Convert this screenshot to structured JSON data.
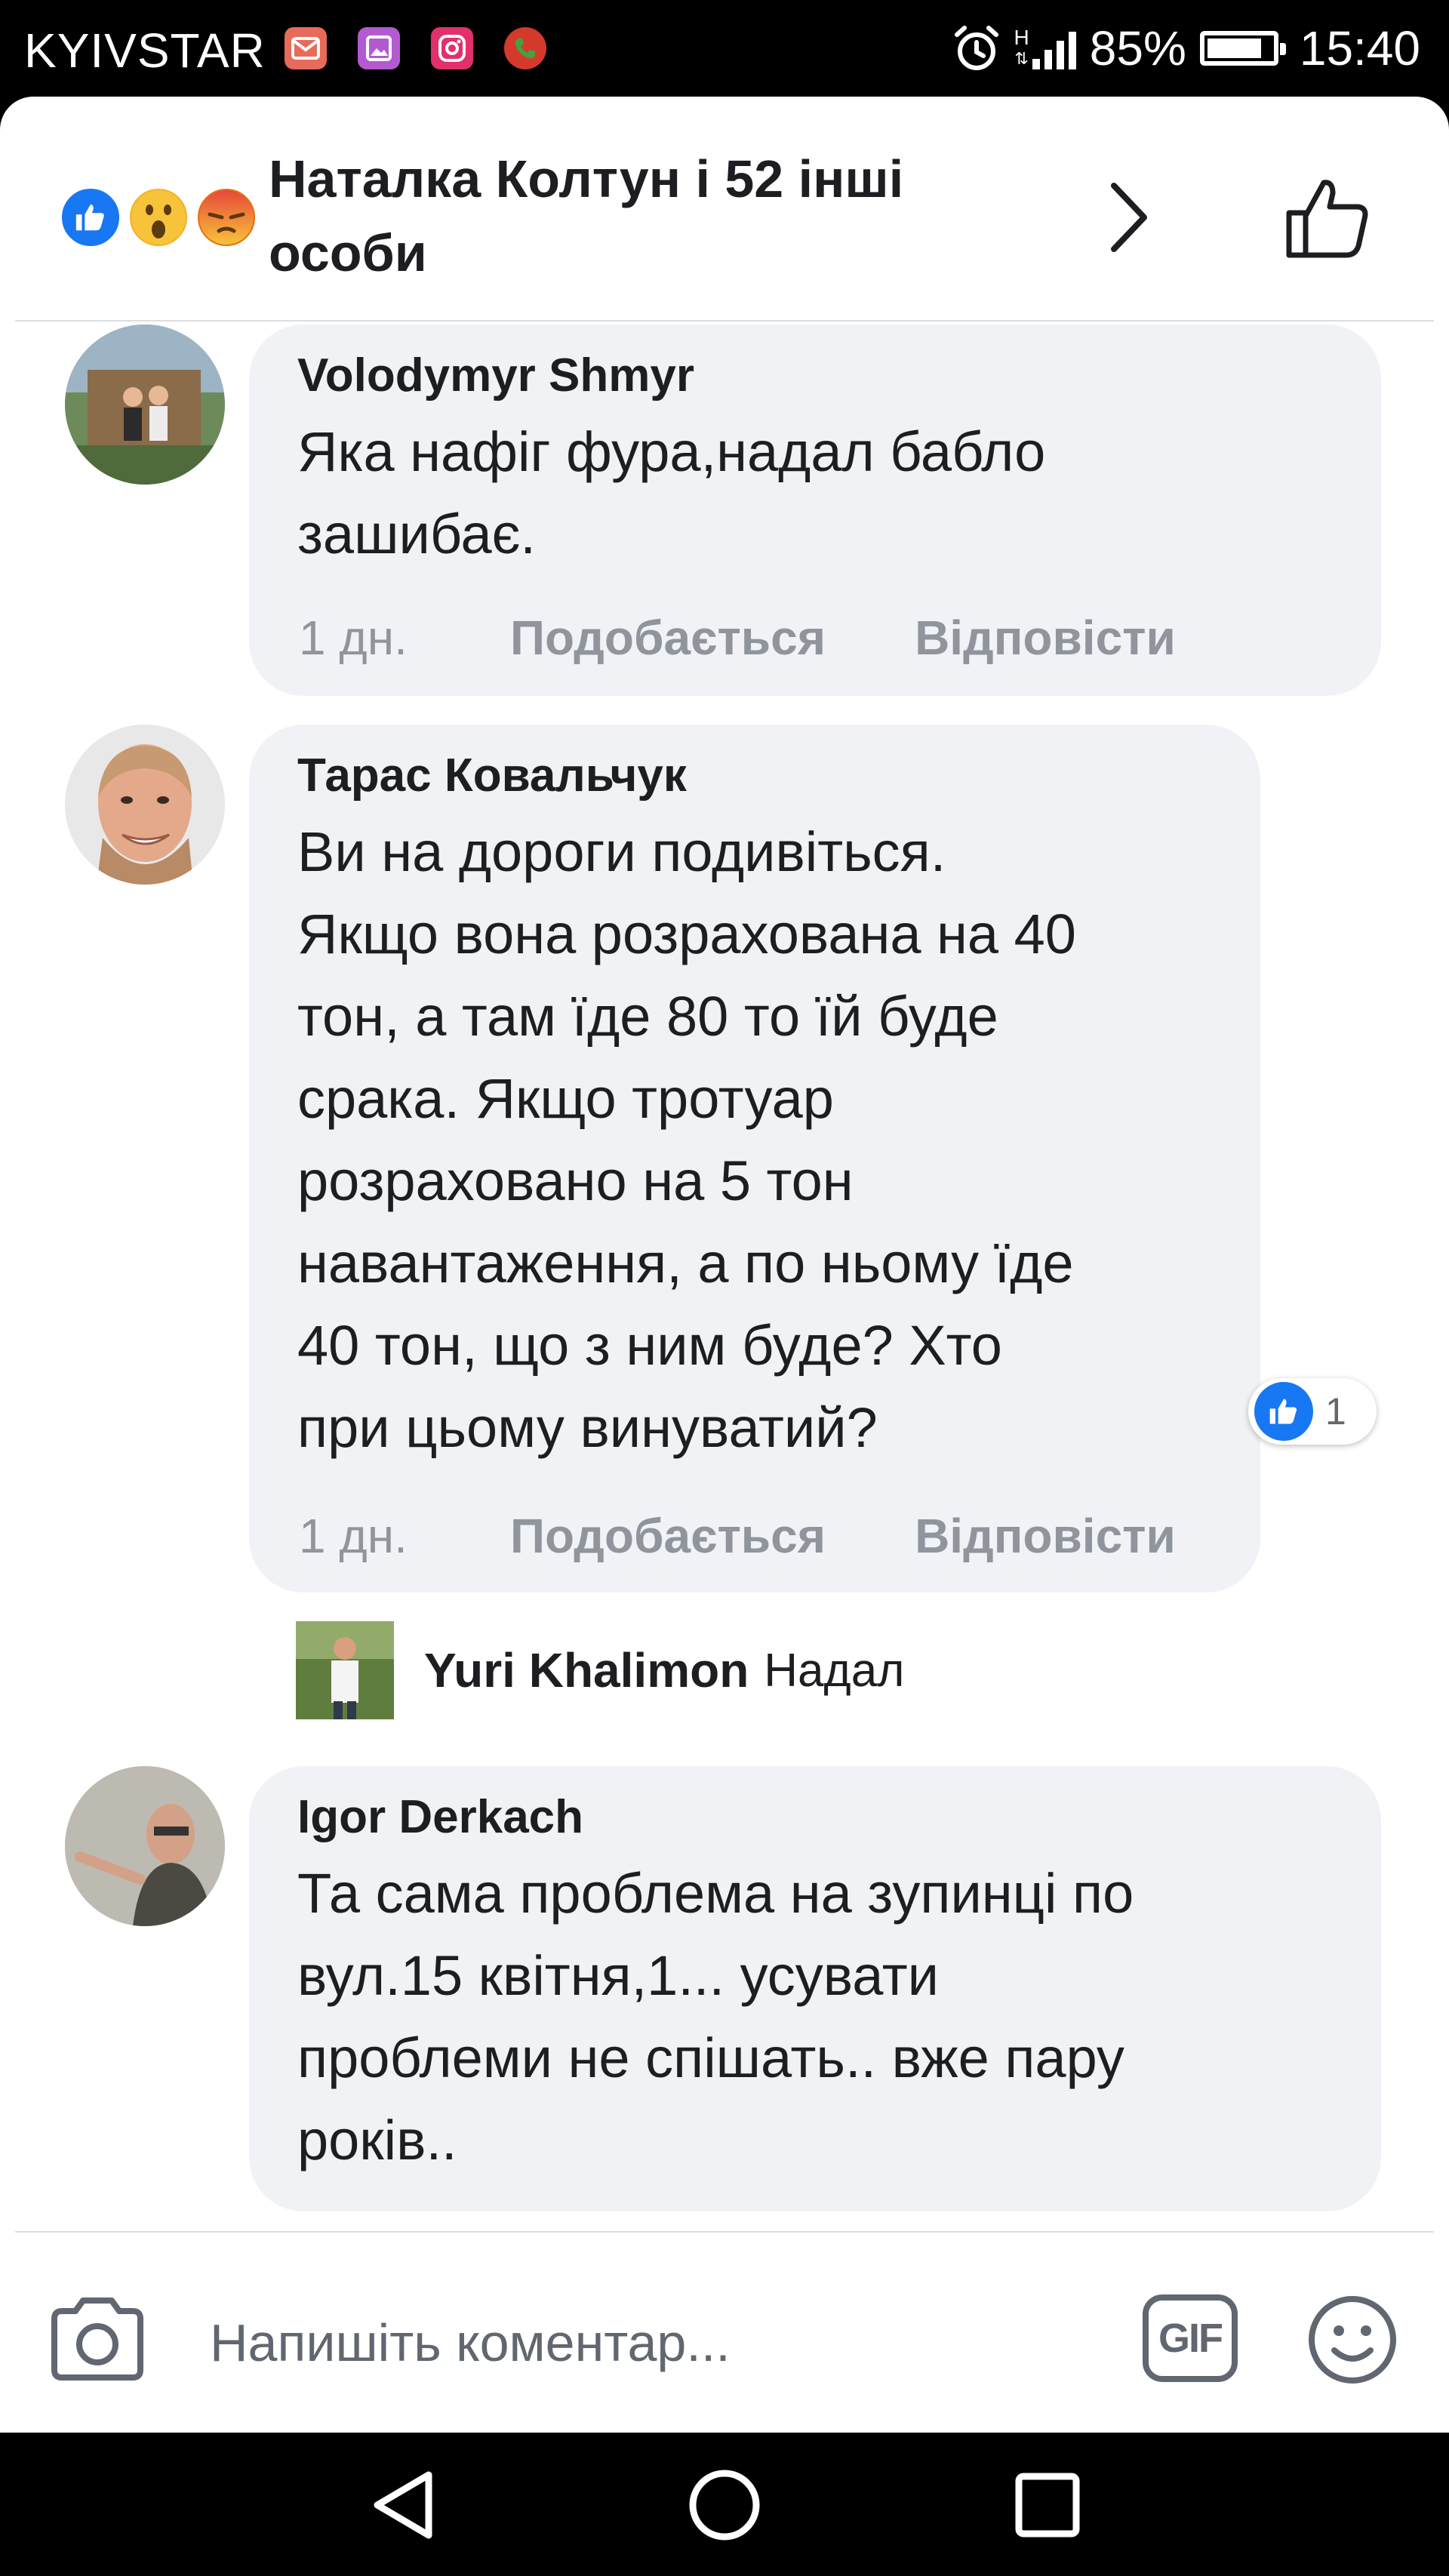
{
  "status_bar": {
    "carrier": "KYIVSTAR",
    "network_type": "H",
    "battery_percent": "85%",
    "battery_level": 0.85,
    "time": "15:40",
    "app_icons": [
      "mail-icon",
      "gallery-icon",
      "instagram-icon",
      "phone-icon"
    ]
  },
  "header": {
    "reactions": [
      "like",
      "wow",
      "angry"
    ],
    "reactors_text": "Наталка Колтун і 52 інші особи"
  },
  "comments": [
    {
      "author": "Volodymyr Shmyr",
      "text": "Яка нафіг фура,надал бабло\nзашибає.",
      "time": "1 дн.",
      "like_label": "Подобається",
      "reply_label": "Відповісти"
    },
    {
      "author": "Тарас Ковальчук",
      "text": "Ви на дороги подивіться.\nЯкщо вона розрахована на 40\nтон, а там їде 80 то їй буде\nсрака. Якщо тротуар\nрозраховано на 5 тон\nнавантаження, а по ньому їде\n40 тон, що з ним буде? Хто\nпри цьому винуватий?",
      "time": "1 дн.",
      "like_label": "Подобається",
      "reply_label": "Відповісти",
      "reaction_count": "1"
    },
    {
      "author": "Igor Derkach",
      "text": "Та сама проблема на зупинці по\nвул.15 квітня,1... усувати\nпроблеми не спішать.. вже пару\nроків.."
    }
  ],
  "reply": {
    "author": "Yuri Khalimon",
    "preview": "Надал"
  },
  "composer": {
    "placeholder": "Напишіть коментар...",
    "gif_label": "GIF"
  },
  "colors": {
    "facebook_blue": "#1877f2",
    "bubble_bg": "#f0f2f5",
    "meta_gray": "#90949c",
    "angry_orange": "#e9710f"
  }
}
